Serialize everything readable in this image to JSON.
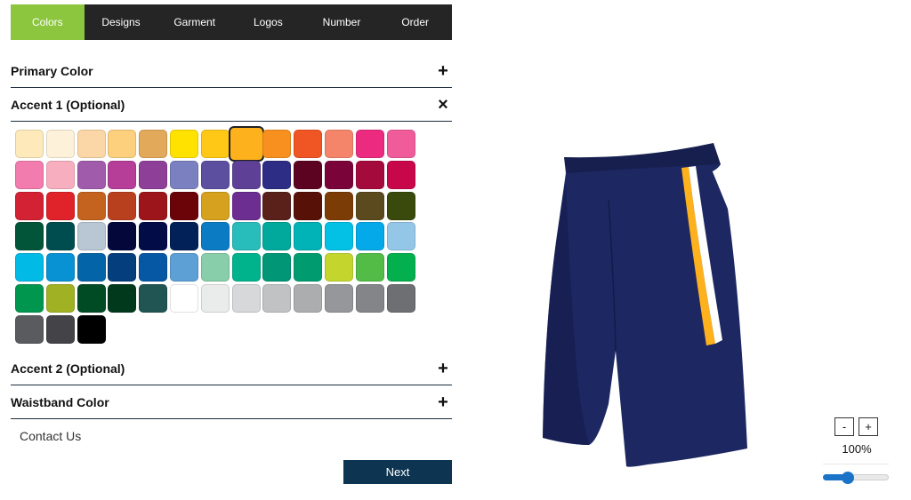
{
  "tabs": [
    {
      "label": "Colors",
      "active": true
    },
    {
      "label": "Designs",
      "active": false
    },
    {
      "label": "Garment",
      "active": false
    },
    {
      "label": "Logos",
      "active": false
    },
    {
      "label": "Number",
      "active": false
    },
    {
      "label": "Order",
      "active": false
    }
  ],
  "sections": {
    "primary": {
      "title": "Primary Color",
      "icon": "plus-icon",
      "symbol": "+"
    },
    "accent1": {
      "title": "Accent 1 (Optional)",
      "icon": "close-icon",
      "symbol": "×"
    },
    "accent2": {
      "title": "Accent 2 (Optional)",
      "icon": "plus-icon",
      "symbol": "+"
    },
    "waistband": {
      "title": "Waistband Color",
      "icon": "plus-icon",
      "symbol": "+"
    }
  },
  "palette": {
    "selected_index": 7,
    "colors": [
      "#fde9b9",
      "#fdf1d9",
      "#fbd6a6",
      "#fdd07d",
      "#e3a95a",
      "#ffe200",
      "#ffc817",
      "#fdb11d",
      "#f7901e",
      "#f05524",
      "#f5856a",
      "#ec2a7f",
      "#f05c9a",
      "#f27cae",
      "#f7afc0",
      "#a05cab",
      "#b63e98",
      "#8e3f97",
      "#7b80c1",
      "#5c4fa0",
      "#5e4196",
      "#2d2d86",
      "#5d0322",
      "#7a0439",
      "#a50a3d",
      "#c8074b",
      "#d22234",
      "#e0222a",
      "#c4621f",
      "#b8401f",
      "#9c151a",
      "#6b0409",
      "#d5a11e",
      "#6c2e91",
      "#5a211b",
      "#571107",
      "#7c3c06",
      "#5c4a1f",
      "#3a4a0c",
      "#03553a",
      "#004d4f",
      "#b8c7d3",
      "#03073a",
      "#020c47",
      "#022158",
      "#0b7bc4",
      "#28bcbb",
      "#01a99d",
      "#01b2b6",
      "#03c0e5",
      "#03a9e8",
      "#94c6e8",
      "#01bae5",
      "#0891d3",
      "#0464a8",
      "#043e7c",
      "#0658a5",
      "#5da0d6",
      "#88ceaa",
      "#01b38c",
      "#019676",
      "#009c6f",
      "#c4d62e",
      "#53bc47",
      "#04b04d",
      "#00964e",
      "#a1b124",
      "#004a24",
      "#00391c",
      "#205554",
      "#ffffff",
      "#eaebeb",
      "#d7d8d9",
      "#c1c2c4",
      "#acadaf",
      "#96979a",
      "#848589",
      "#6e6f72",
      "#5a5b5f",
      "#444448",
      "#000000"
    ]
  },
  "contact_label": "Contact Us",
  "next_label": "Next",
  "zoom": {
    "minus": "-",
    "plus": "+",
    "level_text": "100%",
    "slider_fraction": 0.38
  },
  "shorts": {
    "body_color": "#1d2761",
    "shade_color": "#121a48",
    "accent1_color": "#fdb11d",
    "accent2_color": "#ffffff"
  }
}
